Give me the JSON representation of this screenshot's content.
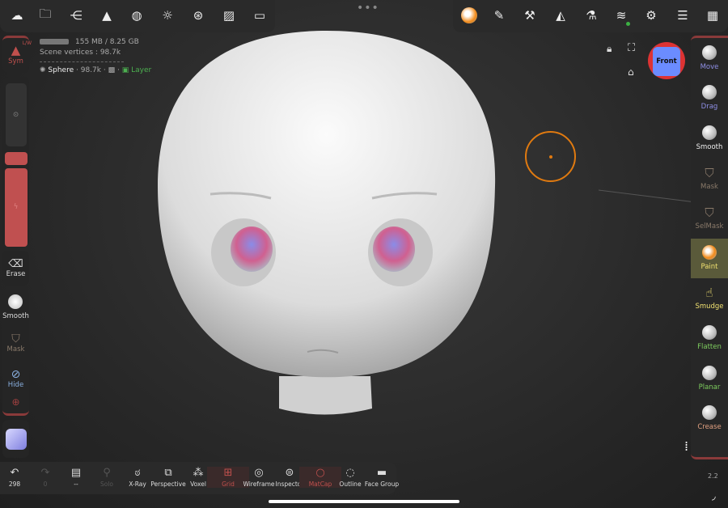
{
  "top_left_toolbar": {
    "icons": [
      "cloud-icon",
      "folder-icon",
      "scene-graph-icon",
      "topology-icon",
      "material-sphere-icon",
      "light-icon",
      "render-icon",
      "background-image-icon",
      "camera-icon"
    ]
  },
  "top_right_toolbar": {
    "icons": [
      "paint-material-icon",
      "brush-stroke-icon",
      "tool-settings-icon",
      "symmetry-icon",
      "experimental-icon",
      "layers-icon",
      "settings-icon",
      "sliders-icon",
      "interface-icon"
    ],
    "accent": "#f08a1a",
    "layers_indicator_color": "#3cb043"
  },
  "info": {
    "memory": "155 MB / 8.25 GB",
    "vertices": "Scene vertices : 98.7k",
    "mesh_name": "Sphere",
    "mesh_vertices": "· 98.7k ·",
    "sep": "·",
    "layer": "Layer"
  },
  "left_panel": {
    "sym": "Sym",
    "sym_badge": "L/W",
    "erase": "Erase",
    "smooth": "Smooth",
    "mask": "Mask",
    "hide": "Hide"
  },
  "right_tools": [
    {
      "label": "Move",
      "color": "#8f8fe6"
    },
    {
      "label": "Drag",
      "color": "#8f8fe6"
    },
    {
      "label": "Smooth",
      "color": "#eeeeee"
    },
    {
      "label": "Mask",
      "color": "#8a7a6a"
    },
    {
      "label": "SelMask",
      "color": "#8a7a6a"
    },
    {
      "label": "Paint",
      "color": "#f0e070"
    },
    {
      "label": "Smudge",
      "color": "#f0e070"
    },
    {
      "label": "Flatten",
      "color": "#7fcf5f"
    },
    {
      "label": "Planar",
      "color": "#7fcf5f"
    },
    {
      "label": "Crease",
      "color": "#e0a080"
    }
  ],
  "gizmo": {
    "label": "Front"
  },
  "version_value": "2.2",
  "bottom_bar": [
    {
      "icon": "undo-icon",
      "label": "298"
    },
    {
      "icon": "redo-icon",
      "label": "0"
    },
    {
      "icon": "notes-icon",
      "label": "--"
    },
    {
      "icon": "search-icon",
      "label": "Solo"
    },
    {
      "icon": "glasses-icon",
      "label": "X-Ray"
    },
    {
      "icon": "perspective-icon",
      "label": "Perspective"
    },
    {
      "icon": "voxel-icon",
      "label": "Voxel"
    },
    {
      "icon": "grid-icon",
      "label": "Grid"
    },
    {
      "icon": "wireframe-icon",
      "label": "Wireframe"
    },
    {
      "icon": "inspector-icon",
      "label": "Inspector"
    },
    {
      "icon": "matcap-icon",
      "label": "MatCap"
    },
    {
      "icon": "outline-icon",
      "label": "Outline"
    },
    {
      "icon": "face-group-icon",
      "label": "Face Group"
    }
  ]
}
